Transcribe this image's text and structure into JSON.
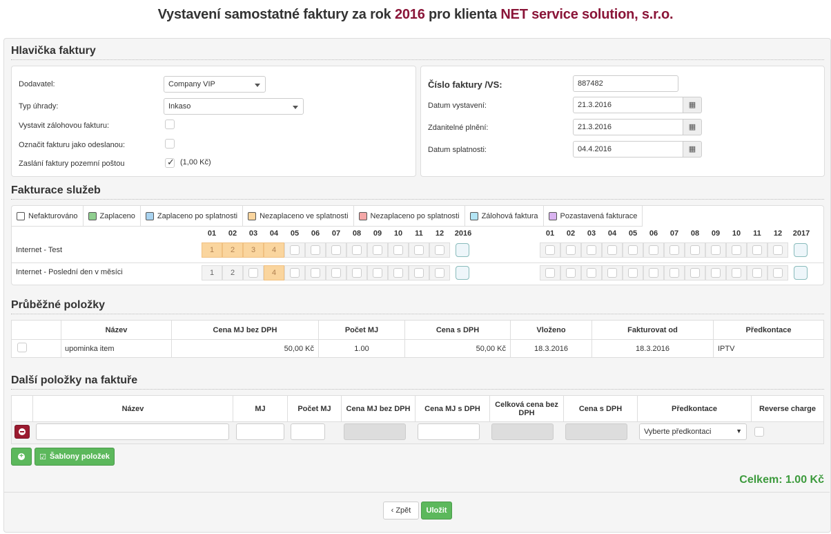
{
  "title": {
    "prefix": "Vystavení samostatné faktury za rok ",
    "year": "2016",
    "middle": " pro klienta ",
    "client": "NET service solution, s.r.o."
  },
  "header": {
    "section_title": "Hlavička faktury",
    "supplier_label": "Dodavatel:",
    "supplier_value": "Company VIP",
    "payment_label": "Typ úhrady:",
    "payment_value": "Inkaso",
    "advance_label": "Vystavit zálohovou fakturu:",
    "sent_label": "Označit fakturu jako odeslanou:",
    "post_label": "Zaslání faktury pozemní poštou",
    "post_price": "(1,00 Kč)",
    "invoice_no_label": "Číslo faktury /VS:",
    "invoice_no_value": "887482",
    "issue_label": "Datum vystavení:",
    "issue_value": "21.3.2016",
    "taxable_label": "Zdanitelné plnění:",
    "taxable_value": "21.3.2016",
    "due_label": "Datum splatnosti:",
    "due_value": "04.4.2016"
  },
  "services": {
    "section_title": "Fakturace služeb",
    "legend": [
      {
        "label": "Nefakturováno",
        "color": "#ffffff"
      },
      {
        "label": "Zaplaceno",
        "color": "#8fce8f"
      },
      {
        "label": "Zaplaceno po splatnosti",
        "color": "#a9d3f0"
      },
      {
        "label": "Nezaplaceno ve splatnosti",
        "color": "#fad59e"
      },
      {
        "label": "Nezaplaceno po splatnosti",
        "color": "#f4a7a7"
      },
      {
        "label": "Zálohová faktura",
        "color": "#b3e5f5"
      },
      {
        "label": "Pozastavená fakturace",
        "color": "#d9b3f0"
      }
    ],
    "months": [
      "01",
      "02",
      "03",
      "04",
      "05",
      "06",
      "07",
      "08",
      "09",
      "10",
      "11",
      "12"
    ],
    "year1": "2016",
    "year2": "2017",
    "rows": [
      {
        "label": "Internet - Test",
        "m1": "1",
        "m2": "2",
        "m3": "3",
        "m4": "4"
      },
      {
        "label": "Internet - Poslední den v měsíci",
        "m1": "1",
        "m2": "2",
        "m4": "4"
      }
    ]
  },
  "running": {
    "section_title": "Průběžné položky",
    "columns": [
      "Název",
      "Cena MJ bez DPH",
      "Počet MJ",
      "Cena s DPH",
      "Vloženo",
      "Fakturovat od",
      "Předkontace"
    ],
    "row": {
      "name": "upominka item",
      "price": "50,00 Kč",
      "qty": "1.00",
      "price_vat": "50,00 Kč",
      "inserted": "18.3.2016",
      "bill_from": "18.3.2016",
      "account": "IPTV"
    }
  },
  "other": {
    "section_title": "Další položky na faktuře",
    "col_name": "Název",
    "col_mj": "MJ",
    "col_qty": "Počet MJ",
    "col_price": "Cena MJ bez DPH",
    "col_price_vat": "Cena MJ s DPH",
    "col_total": "Celková cena bez DPH",
    "col_total_vat": "Cena s DPH",
    "col_account": "Předkontace",
    "col_reverse": "Reverse charge",
    "account_placeholder": "Vyberte předkontaci",
    "templates_label": "Šablony položek"
  },
  "total_label": "Celkem: 1.00 Kč",
  "back_label": "Zpět",
  "save_label": "Uložit"
}
